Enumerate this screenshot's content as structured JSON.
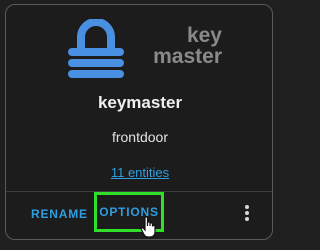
{
  "logo": {
    "text_line1": "key",
    "text_line2": "master",
    "icon": "lock-icon",
    "icon_color": "#4a90e2"
  },
  "integration": {
    "title": "keymaster",
    "subtitle": "frontdoor",
    "entities_link": "11 entities"
  },
  "actions": {
    "rename_label": "RENAME",
    "options_label": "OPTIONS",
    "menu_icon": "more-vertical-icon",
    "cursor_icon": "hand-pointer-icon"
  },
  "colors": {
    "accent": "#2f9de0",
    "highlight": "#2ee02a",
    "card_background": "#1c1c1c"
  }
}
